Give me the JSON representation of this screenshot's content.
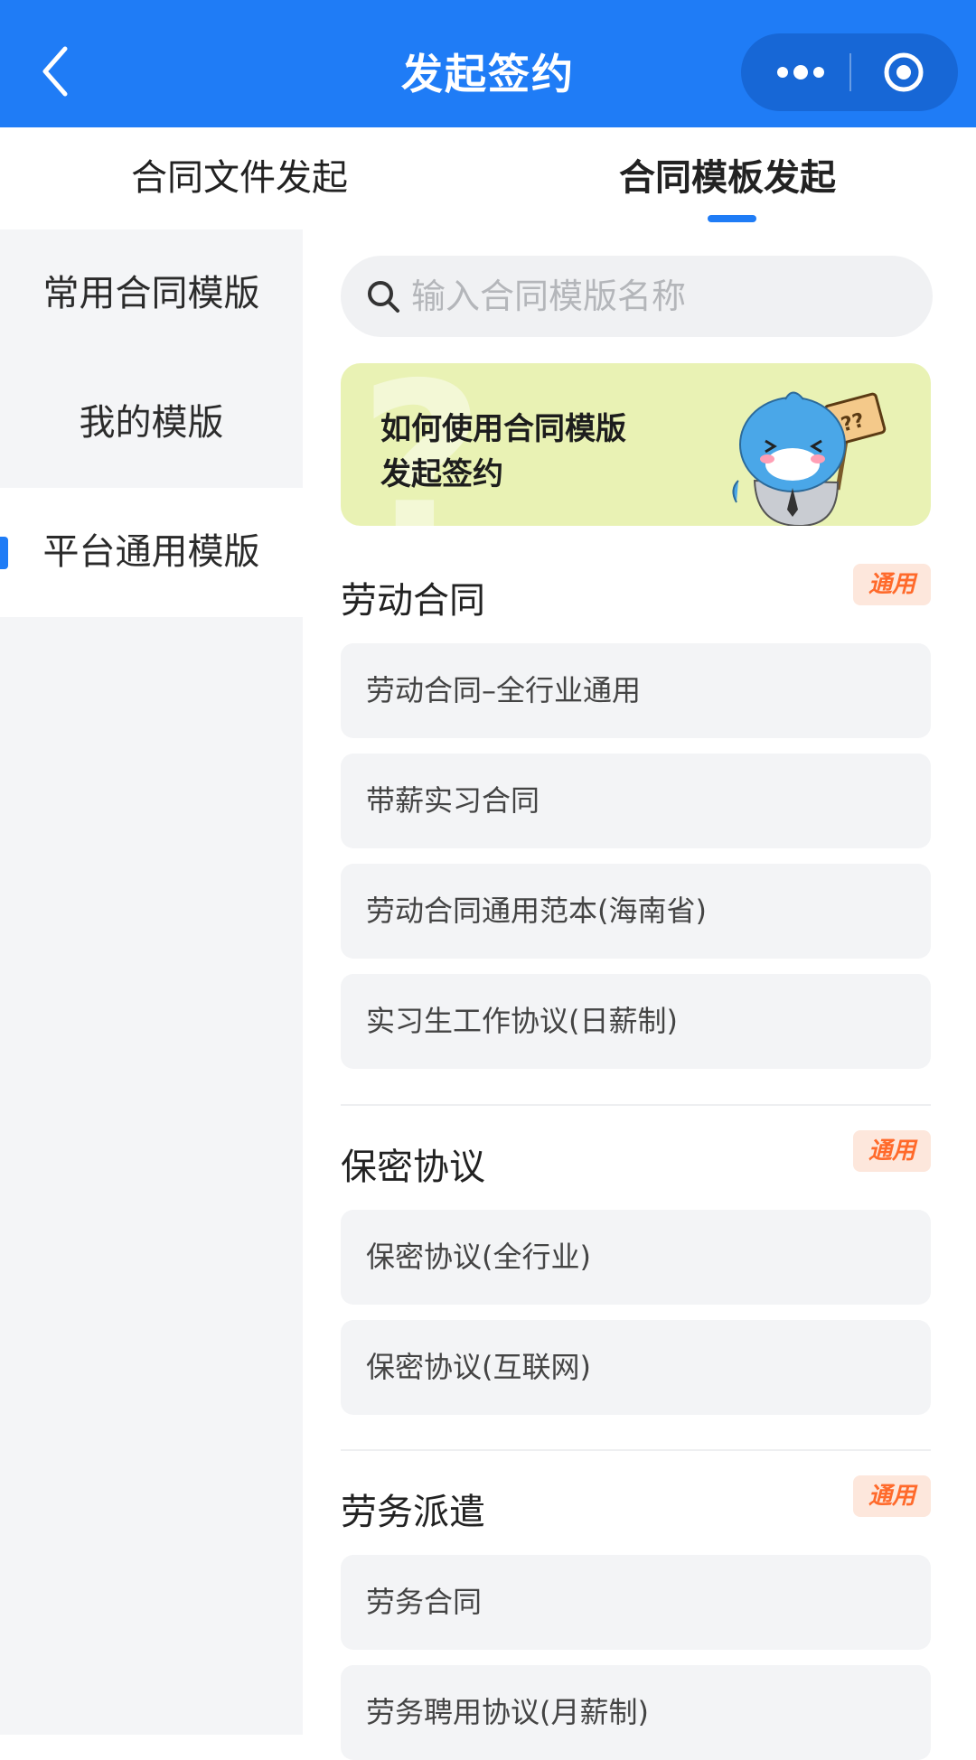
{
  "header": {
    "title": "发起签约",
    "back_icon": "chevron-left-icon",
    "more_icon": "more-dots-icon",
    "close_icon": "target-circle-icon",
    "background_color": "#1f7cf6"
  },
  "tabs": [
    {
      "label": "合同文件发起",
      "active": false
    },
    {
      "label": "合同模板发起",
      "active": true
    }
  ],
  "sidebar": {
    "items": [
      {
        "label": "常用合同模版",
        "active": false
      },
      {
        "label": "我的模版",
        "active": false
      },
      {
        "label": "平台通用模版",
        "active": true
      }
    ]
  },
  "search": {
    "placeholder": "输入合同模版名称",
    "value": ""
  },
  "banner": {
    "line1": "如何使用合同模版",
    "line2": "发起签约",
    "mascot_sign": "??",
    "background_color": "#e9f2b4"
  },
  "sections": [
    {
      "title": "劳动合同",
      "badge": "通用",
      "items": [
        "劳动合同–全行业通用",
        "带薪实习合同",
        "劳动合同通用范本(海南省)",
        "实习生工作协议(日薪制)"
      ]
    },
    {
      "title": "保密协议",
      "badge": "通用",
      "items": [
        "保密协议(全行业)",
        "保密协议(互联网)"
      ]
    },
    {
      "title": "劳务派遣",
      "badge": "通用",
      "items": [
        "劳务合同",
        "劳务聘用协议(月薪制)"
      ]
    }
  ],
  "colors": {
    "accent": "#1f7cf6",
    "badge_text": "#ff6a2b",
    "badge_bg": "#fde7dc"
  }
}
